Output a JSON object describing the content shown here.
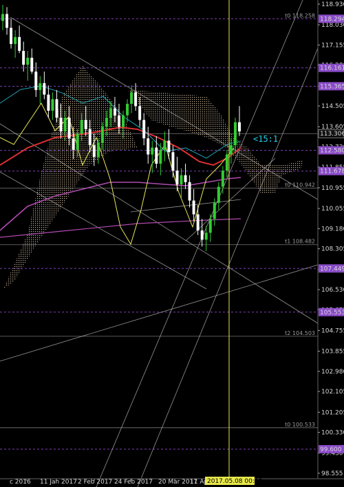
{
  "chart_data": {
    "type": "line",
    "instrument_view": "Candlestick chart with Ichimoku cloud and trendlines",
    "colors": {
      "background": "#000000",
      "bull_candle": "#32cd32",
      "bear_candle": "#ffffff",
      "cloud": "#d9c2a6",
      "red_ma": "#e03030",
      "magenta_ma": "#b04ab0",
      "yellow_osc": "#e8e85a",
      "cyan_line": "#20b8c8",
      "trend_lines": "#c8c8c8",
      "horiz_white": "#cccccc",
      "horiz_purple": "#8a4ac8",
      "cursor_vline": "#e7e74b"
    },
    "y_axis": {
      "range": [
        98.555,
        118.93
      ],
      "tick_labels": [
        "118.930",
        "118.030",
        "117.155",
        "116.280",
        "115.365",
        "114.505",
        "113.605",
        "112.730",
        "111.855",
        "110.955",
        "110.055",
        "109.180",
        "108.305",
        "107.405",
        "106.530",
        "105.655",
        "104.755",
        "103.855",
        "102.980",
        "102.105",
        "101.205",
        "100.330",
        "99.430",
        "98.555"
      ]
    },
    "x_axis": {
      "tick_labels": [
        "c 2016",
        "11 Jan 2017",
        "2 Feb 2017",
        "24 Feb 2017",
        "20 Mar 2017",
        "11 Apr 2",
        "2017.05.08 00:00"
      ]
    },
    "price_labels": [
      {
        "text": "118.294",
        "kind": "purple"
      },
      {
        "text": "116.161",
        "kind": "purple"
      },
      {
        "text": "115.365",
        "kind": "purple"
      },
      {
        "text": "113.306",
        "kind": "white"
      },
      {
        "text": "112.580",
        "kind": "purple"
      },
      {
        "text": "111.678",
        "kind": "purple"
      },
      {
        "text": "107.449",
        "kind": "purple"
      },
      {
        "text": "105.553",
        "kind": "purple"
      },
      {
        "text": "99.600",
        "kind": "purple"
      }
    ],
    "horizontal_levels": [
      {
        "value": 118.294,
        "label": "t0 118.258",
        "style": "purple-dashed"
      },
      {
        "value": 116.161,
        "label": "",
        "style": "purple-dashed"
      },
      {
        "value": 115.365,
        "label": "",
        "style": "purple-dashed"
      },
      {
        "value": 113.306,
        "label": "",
        "style": "white"
      },
      {
        "value": 112.58,
        "label": "",
        "style": "purple-dashed"
      },
      {
        "value": 111.678,
        "label": "",
        "style": "purple-dashed"
      },
      {
        "value": 110.942,
        "label": "t0 110.942",
        "style": "white"
      },
      {
        "value": 108.482,
        "label": "t1 108.482",
        "style": "white"
      },
      {
        "value": 107.449,
        "label": "",
        "style": "purple-dashed"
      },
      {
        "value": 105.553,
        "label": "",
        "style": "purple-dashed"
      },
      {
        "value": 104.503,
        "label": "t2 104.503",
        "style": "white"
      },
      {
        "value": 100.533,
        "label": "t0 100.533",
        "style": "white"
      },
      {
        "value": 99.6,
        "label": "",
        "style": "purple-dashed"
      }
    ],
    "annotations": [
      {
        "text": "<15:1"
      }
    ],
    "candles": [
      [
        118.2,
        118.9,
        117.8,
        118.5
      ],
      [
        118.5,
        118.8,
        117.6,
        117.9
      ],
      [
        117.9,
        118.3,
        117.0,
        117.2
      ],
      [
        117.2,
        117.8,
        116.6,
        117.5
      ],
      [
        117.5,
        118.0,
        116.8,
        116.9
      ],
      [
        116.9,
        117.3,
        116.0,
        116.3
      ],
      [
        116.3,
        116.9,
        115.6,
        116.6
      ],
      [
        116.6,
        117.0,
        115.9,
        116.0
      ],
      [
        116.0,
        116.4,
        114.9,
        115.2
      ],
      [
        115.2,
        115.8,
        114.6,
        115.5
      ],
      [
        115.5,
        116.0,
        114.8,
        115.0
      ],
      [
        115.0,
        115.4,
        114.0,
        114.3
      ],
      [
        114.3,
        115.1,
        113.9,
        114.8
      ],
      [
        114.8,
        115.2,
        113.8,
        114.0
      ],
      [
        114.0,
        114.6,
        113.1,
        113.4
      ],
      [
        113.4,
        114.3,
        113.0,
        114.0
      ],
      [
        114.0,
        114.5,
        112.8,
        113.1
      ],
      [
        113.1,
        113.6,
        112.2,
        112.6
      ],
      [
        112.6,
        113.5,
        112.3,
        113.3
      ],
      [
        113.3,
        114.2,
        113.0,
        113.9
      ],
      [
        113.9,
        114.5,
        113.2,
        113.5
      ],
      [
        113.5,
        113.9,
        112.5,
        112.8
      ],
      [
        112.8,
        113.3,
        111.9,
        112.3
      ],
      [
        112.3,
        113.1,
        112.0,
        112.9
      ],
      [
        112.9,
        113.8,
        112.6,
        113.6
      ],
      [
        113.6,
        114.3,
        113.2,
        114.0
      ],
      [
        114.0,
        114.7,
        113.6,
        114.4
      ],
      [
        114.4,
        114.9,
        113.8,
        114.1
      ],
      [
        114.1,
        114.6,
        113.3,
        113.6
      ],
      [
        113.6,
        114.3,
        113.1,
        114.1
      ],
      [
        114.1,
        114.8,
        113.8,
        114.6
      ],
      [
        114.6,
        115.4,
        114.2,
        115.1
      ],
      [
        115.1,
        115.5,
        114.3,
        114.5
      ],
      [
        114.5,
        114.9,
        113.6,
        113.9
      ],
      [
        113.9,
        114.2,
        112.8,
        113.1
      ],
      [
        113.1,
        113.6,
        112.0,
        112.4
      ],
      [
        112.4,
        113.0,
        111.6,
        112.7
      ],
      [
        112.7,
        113.2,
        111.8,
        112.0
      ],
      [
        112.0,
        112.9,
        111.5,
        112.6
      ],
      [
        112.6,
        113.4,
        112.1,
        113.0
      ],
      [
        113.0,
        113.5,
        112.2,
        112.5
      ],
      [
        112.5,
        112.8,
        111.4,
        111.7
      ],
      [
        111.7,
        112.3,
        110.8,
        111.1
      ],
      [
        111.1,
        111.8,
        110.5,
        111.5
      ],
      [
        111.5,
        112.0,
        110.9,
        111.2
      ],
      [
        111.2,
        111.5,
        110.1,
        110.4
      ],
      [
        110.4,
        110.9,
        109.5,
        109.8
      ],
      [
        109.8,
        110.2,
        108.9,
        109.1
      ],
      [
        109.1,
        109.6,
        108.4,
        108.7
      ],
      [
        108.7,
        109.3,
        108.2,
        109.0
      ],
      [
        109.0,
        109.8,
        108.6,
        109.6
      ],
      [
        109.6,
        110.5,
        109.3,
        110.3
      ],
      [
        110.3,
        111.2,
        110.0,
        111.0
      ],
      [
        111.0,
        111.9,
        110.7,
        111.7
      ],
      [
        111.7,
        112.6,
        111.4,
        112.4
      ],
      [
        112.4,
        113.1,
        112.0,
        112.8
      ],
      [
        112.8,
        114.0,
        112.5,
        113.8
      ],
      [
        113.8,
        114.5,
        113.2,
        113.4
      ]
    ]
  }
}
